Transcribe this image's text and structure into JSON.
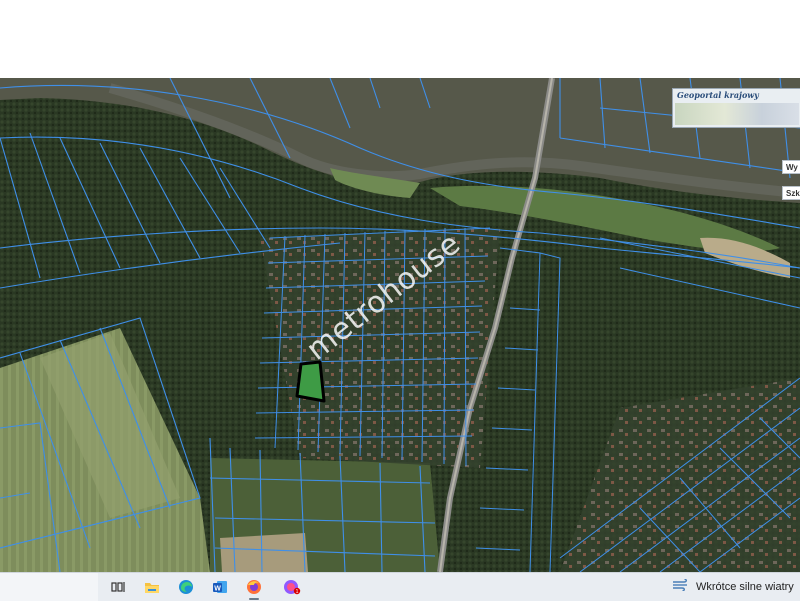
{
  "map": {
    "watermark": "metrohouse",
    "minimap_title": "Geoportal krajowy",
    "side_buttons": [
      "Wy",
      "Szk"
    ],
    "colors": {
      "parcel_lines": "#3f8fe8",
      "highlight_fill": "#3e9b45",
      "highlight_stroke": "#000000",
      "river": "#55574a",
      "forest": "#26331f"
    }
  },
  "taskbar": {
    "icons": [
      "task-view-icon",
      "file-explorer-icon",
      "edge-browser-icon",
      "word-icon",
      "firefox-icon",
      "firefox-dev-icon"
    ],
    "weather_text": "Wkrótce silne wiatry"
  }
}
